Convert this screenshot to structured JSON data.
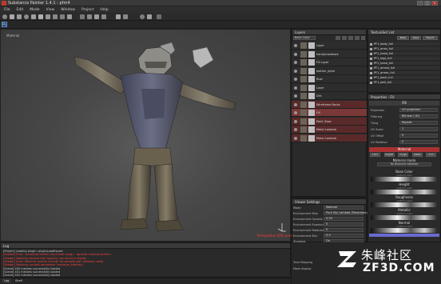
{
  "window": {
    "title": "Substance Painter 1.4.1 - pfm4"
  },
  "menu": [
    "File",
    "Edit",
    "Mode",
    "View",
    "Window",
    "Project",
    "Help"
  ],
  "viewport": {
    "label": "Material",
    "perspective_label": "Perspective (DX) persp0"
  },
  "colors": {
    "accent_red": "#a83232",
    "layer_selected": "#7a3838",
    "viewport_bg": "#474747",
    "log_error": "#ff4040"
  },
  "layers": {
    "title": "Layers",
    "blend": "Base Color",
    "rows": [
      {
        "name": "Layer",
        "style": "normal"
      },
      {
        "name": "hands/cardback",
        "style": "normal"
      },
      {
        "name": "Fill Layer",
        "style": "normal"
      },
      {
        "name": "leather_dyed",
        "style": "normal"
      },
      {
        "name": "Rust",
        "style": "normal"
      },
      {
        "name": "Layer",
        "style": "normal"
      },
      {
        "name": "Dirt",
        "style": "normal"
      },
      {
        "name": "Wireframe Rocks",
        "style": "red"
      },
      {
        "name": "Fill",
        "style": "selected"
      },
      {
        "name": "Paint Glow",
        "style": "red"
      },
      {
        "name": "Metal Lambda",
        "style": "red"
      },
      {
        "name": "Metal Lambda",
        "style": "red"
      }
    ]
  },
  "texture_sets": {
    "title": "TextureSet List",
    "buttons": [
      "Bake",
      "Save",
      "Export"
    ],
    "items": [
      "PF1_body_full",
      "PF1_arms_full",
      "PF1_head_full",
      "PF1_legs_full",
      "PF1_torso_full",
      "PF1_ammo_full",
      "PF1_armor_full",
      "PF1_back_full",
      "PF1_belt_full"
    ]
  },
  "properties": {
    "title": "Properties - Fill",
    "section": "Fill",
    "rows": [
      {
        "key": "Projection",
        "value": "UV projection"
      },
      {
        "key": "Filtering",
        "value": "Bilinear | HQ"
      },
      {
        "key": "Tiling",
        "value": "Repeat"
      },
      {
        "key": "UV Scale",
        "value": "1"
      },
      {
        "key": "UV Offset",
        "value": "0"
      },
      {
        "key": "UV Rotation",
        "value": "0"
      }
    ],
    "material_title": "Material",
    "material_buttons": [
      "color",
      "height",
      "rough",
      "metal",
      "nrm"
    ],
    "material_mode": "Material mode",
    "material_mode_value": "No Resource Selected",
    "channels": [
      {
        "label": "Base Color",
        "sub": "uniform color"
      },
      {
        "label": "Height",
        "sub": "uniform color"
      },
      {
        "label": "Roughness",
        "sub": "uniform color"
      },
      {
        "label": "Metallic",
        "sub": "uniform color"
      },
      {
        "label": "Normal",
        "sub": "uniform color"
      }
    ]
  },
  "shelf": {
    "title": "Viewer Settings",
    "rows": [
      {
        "key": "Mode",
        "value": "Material"
      },
      {
        "key": "Environment Map",
        "value": "Pure Sky Lambda (Panorama)"
      },
      {
        "key": "Environment Opacity",
        "value": "0.35"
      },
      {
        "key": "Environment Exposure (EV)",
        "value": "0"
      },
      {
        "key": "Environment Rotation",
        "value": "0"
      },
      {
        "key": "Environment Blur",
        "value": "0.3"
      },
      {
        "key": "Shadows",
        "value": "On"
      }
    ],
    "footer": [
      "Tone Mapping",
      "Mask display"
    ]
  },
  "log": {
    "title": "Log",
    "lines": [
      {
        "text": "[Project] Loading plugin: pluginLoadExport",
        "level": "info"
      },
      {
        "text": "[Shader] Error: compiling shader 'pbr-metal-rough' - ignored missing uniform",
        "level": "error"
      },
      {
        "text": "[Shader] Warning: texture slot 'opacity' not found in shader",
        "level": "error"
      },
      {
        "text": "[Shader] Error: failed to resolve include 'lib-sampler.glsl' (fallback used)",
        "level": "error"
      },
      {
        "text": "[Shader] Warning: unused parameter 'emissive_intensity'",
        "level": "error"
      },
      {
        "text": "[Scene] 400 meshes successfully loaded",
        "level": "info"
      },
      {
        "text": "[Scene] 401 meshes successfully loaded",
        "level": "info"
      },
      {
        "text": "[Scene] 402 meshes successfully loaded",
        "level": "info"
      }
    ],
    "tabs": [
      "Log",
      "Shelf"
    ]
  },
  "watermark": {
    "cn": "朱峰社区",
    "en": "ZF3D.COM"
  }
}
